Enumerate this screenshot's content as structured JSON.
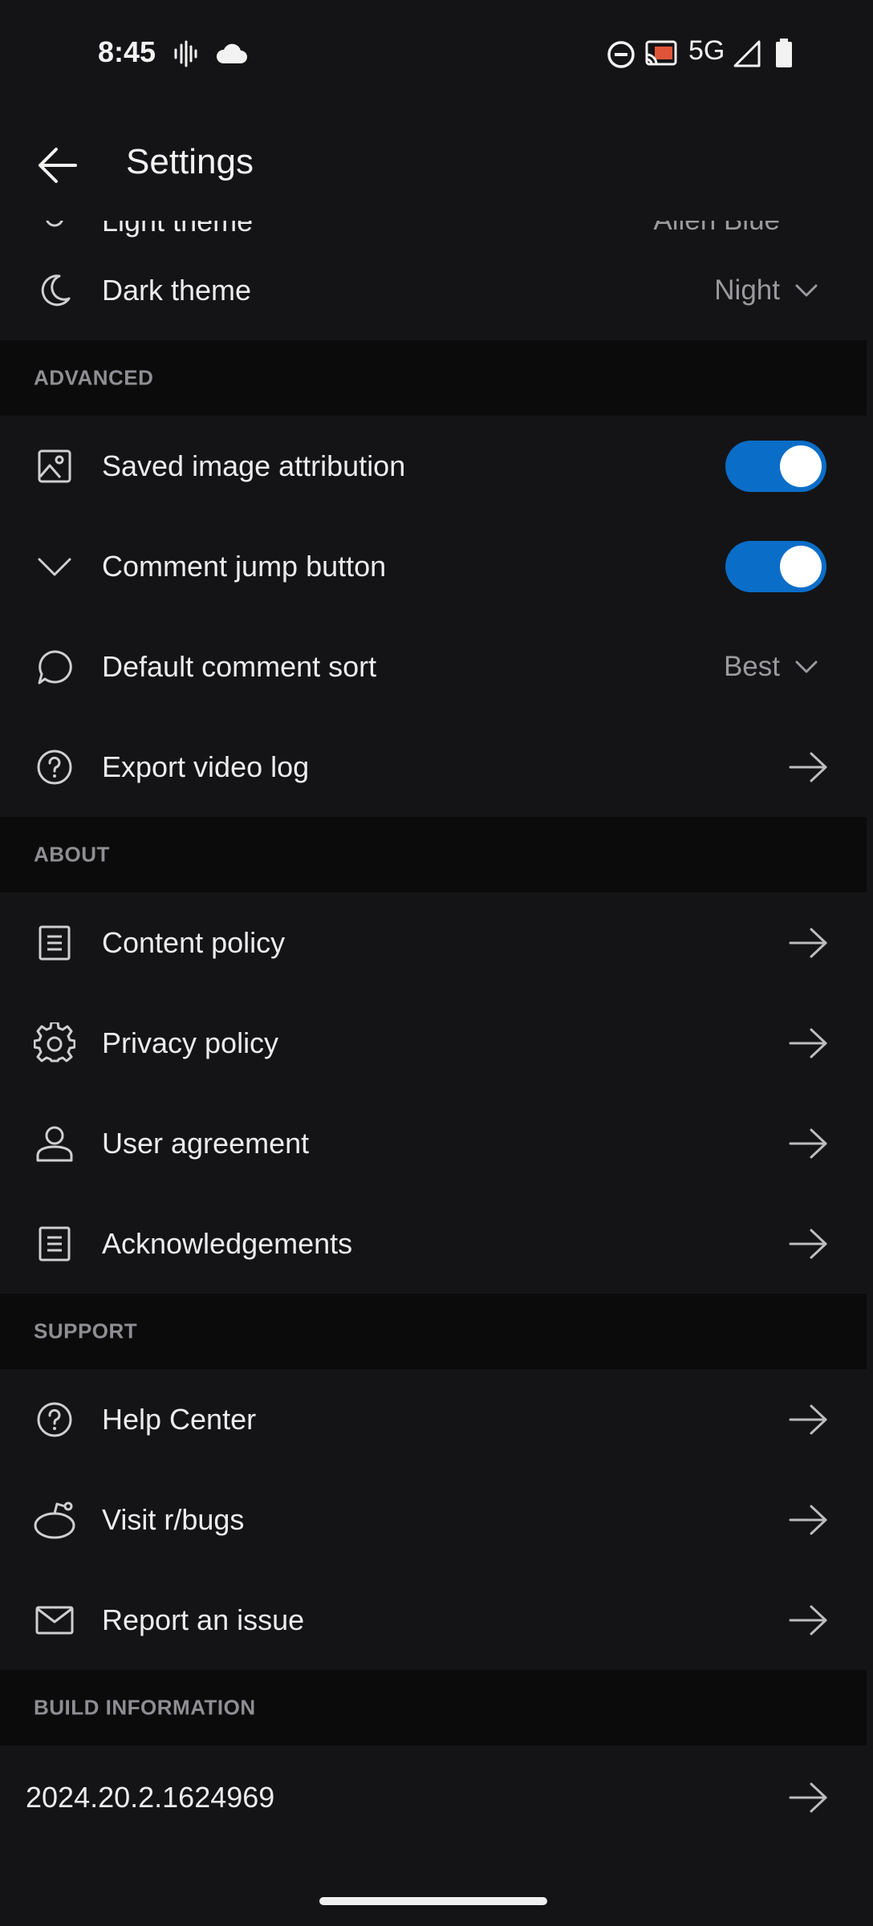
{
  "status_bar": {
    "time": "8:45",
    "network": "5G",
    "icons": [
      "voice-wave-icon",
      "cloud-icon",
      "do-not-disturb-icon",
      "cast-icon",
      "signal-icon",
      "battery-icon"
    ]
  },
  "app_bar": {
    "title": "Settings",
    "back_icon": "back-arrow-icon"
  },
  "partial_row": {
    "label": "Light theme",
    "value": "Alien Blue"
  },
  "theme_rows": [
    {
      "label": "Dark theme",
      "value": "Night",
      "icon": "moon-icon"
    }
  ],
  "sections": {
    "advanced": {
      "header": "ADVANCED",
      "items": [
        {
          "label": "Saved image attribution",
          "icon": "image-icon",
          "toggle": true
        },
        {
          "label": "Comment jump button",
          "icon": "chevron-down-icon",
          "toggle": true
        },
        {
          "label": "Default comment sort",
          "icon": "comment-icon",
          "value": "Best"
        },
        {
          "label": "Export video log",
          "icon": "help-icon"
        }
      ]
    },
    "about": {
      "header": "ABOUT",
      "items": [
        {
          "label": "Content policy",
          "icon": "document-icon"
        },
        {
          "label": "Privacy policy",
          "icon": "gear-icon"
        },
        {
          "label": "User agreement",
          "icon": "user-icon"
        },
        {
          "label": "Acknowledgements",
          "icon": "document-icon"
        }
      ]
    },
    "support": {
      "header": "SUPPORT",
      "items": [
        {
          "label": "Help Center",
          "icon": "help-icon"
        },
        {
          "label": "Visit r/bugs",
          "icon": "reddit-icon"
        },
        {
          "label": "Report an issue",
          "icon": "mail-icon"
        }
      ]
    },
    "build": {
      "header": "BUILD INFORMATION",
      "version": "2024.20.2.1624969"
    }
  },
  "colors": {
    "background": "#141416",
    "section_background": "#0b0b0c",
    "toggle_on": "#0a6dc7",
    "text_primary": "#ececee",
    "text_secondary": "#9a9a9e"
  }
}
